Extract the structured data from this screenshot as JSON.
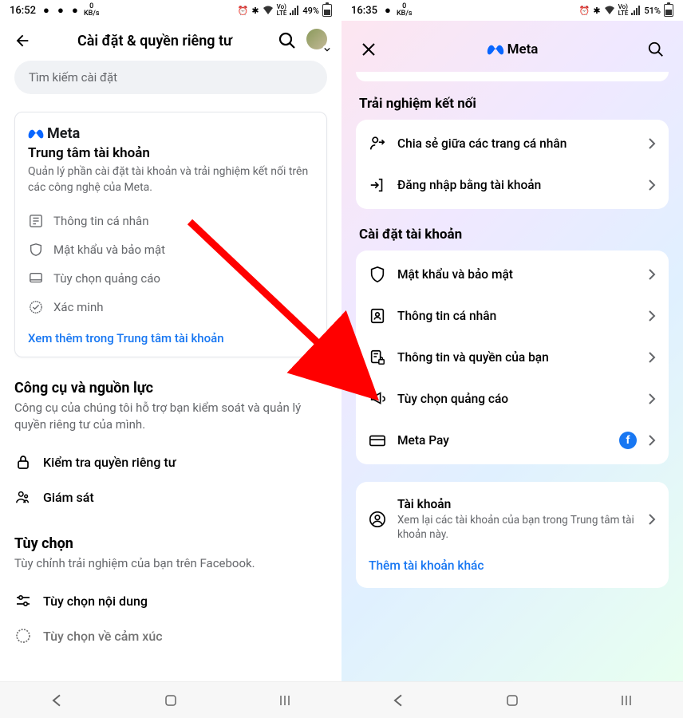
{
  "left": {
    "status": {
      "time": "16:52",
      "net": "0",
      "netunit": "KB/s",
      "batt": "49%"
    },
    "header": {
      "title": "Cài đặt & quyền riêng tư"
    },
    "search_placeholder": "Tìm kiếm cài đặt",
    "meta_brand": "Meta",
    "card": {
      "title": "Trung tâm tài khoản",
      "subtitle": "Quản lý phần cài đặt tài khoản và trải nghiệm kết nối trên các công nghệ của Meta.",
      "items": [
        {
          "label": "Thông tin cá nhân"
        },
        {
          "label": "Mật khẩu và bảo mật"
        },
        {
          "label": "Tùy chọn quảng cáo"
        },
        {
          "label": "Xác minh"
        }
      ],
      "link": "Xem thêm trong Trung tâm tài khoản"
    },
    "tools": {
      "title": "Công cụ và nguồn lực",
      "subtitle": "Công cụ của chúng tôi hỗ trợ bạn kiểm soát và quản lý quyền riêng tư của mình.",
      "items": [
        {
          "label": "Kiểm tra quyền riêng tư"
        },
        {
          "label": "Giám sát"
        }
      ]
    },
    "prefs": {
      "title": "Tùy chọn",
      "subtitle": "Tùy chỉnh trải nghiệm của bạn trên Facebook.",
      "items": [
        {
          "label": "Tùy chọn nội dung"
        },
        {
          "label": "Tùy chọn về cảm xúc"
        }
      ]
    }
  },
  "right": {
    "status": {
      "time": "16:35",
      "net": "0",
      "netunit": "KB/s",
      "batt": "51%"
    },
    "meta_brand": "Meta",
    "sec1": {
      "title": "Trải nghiệm kết nối",
      "items": [
        {
          "label": "Chia sẻ giữa các trang cá nhân"
        },
        {
          "label": "Đăng nhập bằng tài khoản"
        }
      ]
    },
    "sec2": {
      "title": "Cài đặt tài khoản",
      "items": [
        {
          "label": "Mật khẩu và bảo mật"
        },
        {
          "label": "Thông tin cá nhân"
        },
        {
          "label": "Thông tin và quyền của bạn"
        },
        {
          "label": "Tùy chọn quảng cáo"
        },
        {
          "label": "Meta Pay",
          "has_fb": true
        }
      ]
    },
    "account_card": {
      "title": "Tài khoản",
      "subtitle": "Xem lại các tài khoản của bạn trong Trung tâm tài khoản này."
    },
    "add_link": "Thêm tài khoản khác"
  }
}
